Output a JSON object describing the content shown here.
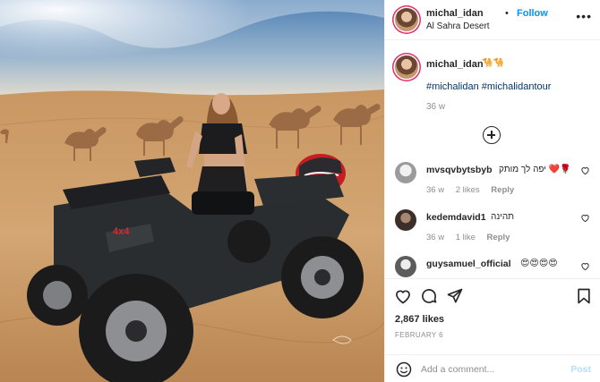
{
  "header": {
    "username": "michal_idan",
    "dot": "•",
    "follow_label": "Follow",
    "location": "Al Sahra Desert",
    "more_icon": "more-horizontal-icon"
  },
  "caption": {
    "username": "michal_idan",
    "emoji": "🐪🐪",
    "hashtags": "#michalidan #michalidantour",
    "time": "36 w"
  },
  "comments": [
    {
      "username": "mvsqvbytsbyb",
      "text": "יפה לך מותק ❤️🌹",
      "time": "36 w",
      "likes": "2 likes",
      "reply": "Reply"
    },
    {
      "username": "kedemdavid1",
      "text": "תהינה",
      "time": "36 w",
      "likes": "1 like",
      "reply": "Reply"
    },
    {
      "username": "guysamuel_official",
      "text": "😍😍😍😍"
    }
  ],
  "actions": {
    "likes": "2,867 likes",
    "date": "FEBRUARY 6"
  },
  "add_comment": {
    "placeholder": "Add a comment...",
    "post_label": "Post"
  },
  "colors": {
    "follow": "#0095f6",
    "hashtag": "#00376b",
    "muted": "#8e8e8e",
    "post_disabled": "#b2dffc",
    "story_ring": "#e1306c"
  }
}
